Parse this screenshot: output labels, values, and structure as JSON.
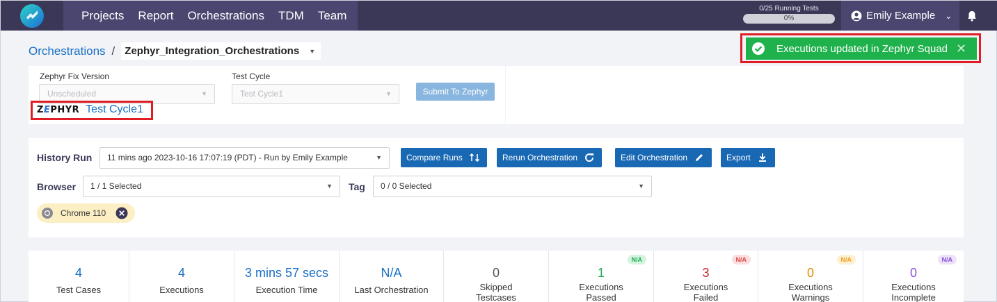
{
  "nav": {
    "items": [
      "Projects",
      "Report",
      "Orchestrations",
      "TDM",
      "Team"
    ],
    "running_tests_label": "0/25 Running Tests",
    "running_tests_percent": "0%",
    "running_tests_progress": 0,
    "user_name": "Emily Example"
  },
  "breadcrumb": {
    "root": "Orchestrations",
    "separator": "/",
    "current": "Zephyr_Integration_Orchestrations"
  },
  "toast": {
    "message": "Executions updated in Zephyr Squad"
  },
  "zephyr": {
    "fix_version_label": "Zephyr Fix Version",
    "fix_version_value": "Unscheduled",
    "test_cycle_label": "Test Cycle",
    "test_cycle_value": "Test Cycle1",
    "submit_label": "Submit To Zephyr",
    "logo_text_a": "Z",
    "logo_text_b": "E",
    "logo_text_c": "PHYR",
    "link_text": "Test Cycle1"
  },
  "history": {
    "history_run_label": "History Run",
    "history_run_value": "11 mins ago 2023-10-16 17:07:19 (PDT) - Run by Emily Example",
    "compare_label": "Compare Runs",
    "rerun_label": "Rerun Orchestration",
    "edit_label": "Edit Orchestration",
    "export_label": "Export",
    "browser_label": "Browser",
    "browser_value": "1 / 1 Selected",
    "tag_label": "Tag",
    "tag_value": "0 / 0 Selected",
    "chip_label": "Chrome 110"
  },
  "stats": [
    {
      "value": "4",
      "label": "Test Cases",
      "color": "#1a6fc4"
    },
    {
      "value": "4",
      "label": "Executions",
      "color": "#1a6fc4"
    },
    {
      "value": "3 mins 57 secs",
      "label": "Execution Time",
      "color": "#1a6fc4"
    },
    {
      "value": "N/A",
      "label": "Last Orchestration",
      "color": "#1a6fc4"
    },
    {
      "value": "0",
      "label": "Skipped",
      "label2": "Testcases",
      "color": "#555555"
    },
    {
      "value": "1",
      "label": "Executions",
      "label2": "Passed",
      "color": "#1fae55",
      "badge": "N/A",
      "badge_bg": "#d6f3df",
      "badge_fg": "#1fae55"
    },
    {
      "value": "3",
      "label": "Executions",
      "label2": "Failed",
      "color": "#cc1f1f",
      "badge": "N/A",
      "badge_bg": "#fbdede",
      "badge_fg": "#e04848"
    },
    {
      "value": "0",
      "label": "Executions",
      "label2": "Warnings",
      "color": "#e28a00",
      "badge": "N/A",
      "badge_bg": "#fdefd2",
      "badge_fg": "#f0a020"
    },
    {
      "value": "0",
      "label": "Executions",
      "label2": "Incomplete",
      "color": "#8a4fd6",
      "badge": "N/A",
      "badge_bg": "#ece2fa",
      "badge_fg": "#8a4fd6"
    }
  ]
}
